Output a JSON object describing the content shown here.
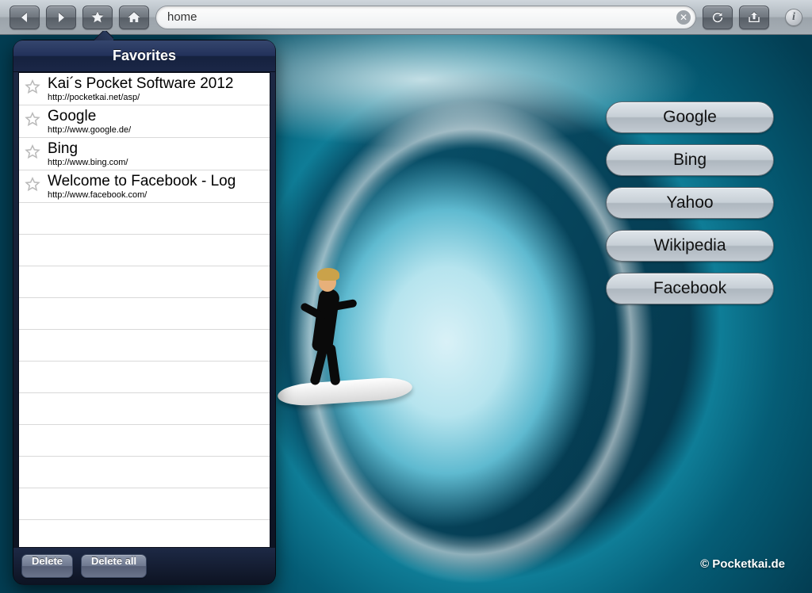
{
  "toolbar": {
    "address_value": "home"
  },
  "popover": {
    "title": "Favorites",
    "delete_label": "Delete",
    "delete_all_label": "Delete all",
    "items": [
      {
        "title": "Kai´s Pocket Software 2012",
        "url": "http://pocketkai.net/asp/"
      },
      {
        "title": "Google",
        "url": "http://www.google.de/"
      },
      {
        "title": "Bing",
        "url": "http://www.bing.com/"
      },
      {
        "title": "Welcome to Facebook - Log",
        "url": "http://www.facebook.com/"
      }
    ]
  },
  "quicklinks": [
    {
      "label": "Google"
    },
    {
      "label": "Bing"
    },
    {
      "label": "Yahoo"
    },
    {
      "label": "Wikipedia"
    },
    {
      "label": "Facebook"
    }
  ],
  "footer": {
    "copyright": "© Pocketkai.de"
  }
}
